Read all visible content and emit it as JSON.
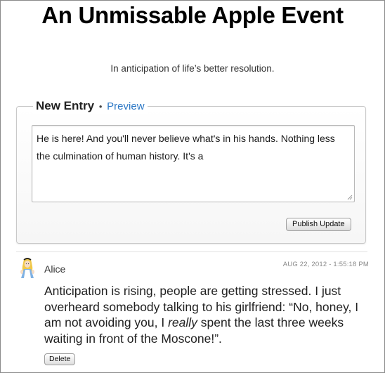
{
  "page": {
    "title": "An Unmissable Apple Event",
    "tagline": "In anticipation of life’s better resolution."
  },
  "entry_form": {
    "legend_title": "New Entry",
    "separator": "•",
    "preview_link": "Preview",
    "text_value": "He is here! And you'll never believe what's in his hands. Nothing less the culmination of human history. It's a",
    "publish_label": "Publish Update"
  },
  "posts": [
    {
      "author": "Alice",
      "avatar_icon": "alice-avatar-icon",
      "timestamp": "AUG 22, 2012 - 1:55:18 PM",
      "body_part1": "Anticipation is rising, people are getting stressed. I just overheard somebody talking to his girlfriend: “No, honey, I am not avoiding you, I ",
      "body_emphasis": "really",
      "body_part2": " spent the last three weeks waiting in front of the Moscone!”.",
      "delete_label": "Delete"
    }
  ],
  "colors": {
    "link": "#2e79c6",
    "timestamp": "#888888"
  }
}
